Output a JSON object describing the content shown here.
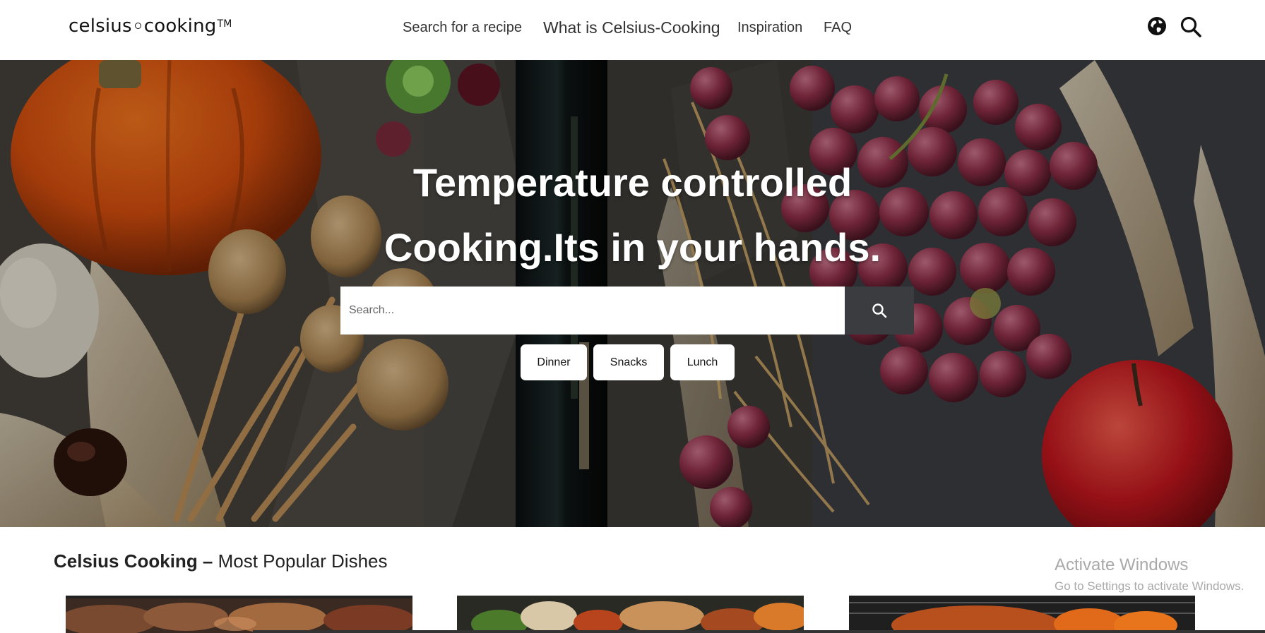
{
  "header": {
    "logo": {
      "part1": "celsius",
      "part2": "cooking",
      "tm": "TM"
    },
    "nav": [
      "Search for a recipe",
      "What is Celsius-Cooking",
      "Inspiration",
      "FAQ"
    ],
    "icons": [
      "globe-icon",
      "search-icon"
    ]
  },
  "hero": {
    "title_line1": "Temperature controlled",
    "title_line2": "Cooking.Its in your hands.",
    "search": {
      "placeholder": "Search...",
      "value": ""
    },
    "chips": [
      "Dinner",
      "Snacks",
      "Lunch"
    ]
  },
  "popular": {
    "title_bold": "Celsius Cooking –",
    "title_rest": " Most Popular Dishes"
  },
  "os_watermark": {
    "line1": "Activate Windows",
    "line2": "Go to Settings to activate Windows."
  },
  "colors": {
    "search_button": "#3a3c3f",
    "hero_overlay": "#2c2e31"
  }
}
